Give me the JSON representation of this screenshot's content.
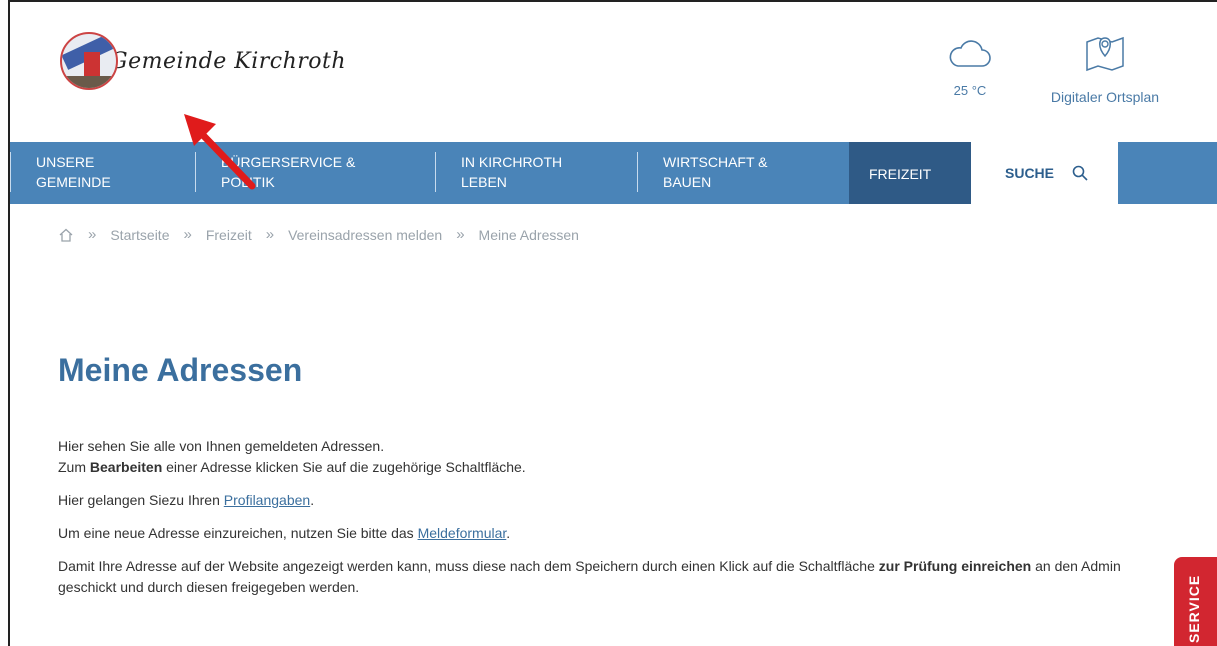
{
  "header": {
    "logo_text": "Gemeinde Kirchroth",
    "weather": {
      "icon": "cloud-icon",
      "temperature": "25 °C"
    },
    "ortsplan": {
      "icon": "map-pin-icon",
      "label": "Digitaler Ortsplan"
    }
  },
  "nav": {
    "items": [
      {
        "line1": "UNSERE",
        "line2": "GEMEINDE"
      },
      {
        "line1": "BÜRGERSERVICE &",
        "line2": "POLITIK"
      },
      {
        "line1": "IN KIRCHROTH",
        "line2": "LEBEN"
      },
      {
        "line1": "WIRTSCHAFT &",
        "line2": "BAUEN"
      }
    ],
    "active": "FREIZEIT",
    "search_label": "SUCHE"
  },
  "breadcrumb": {
    "home_icon": "home-icon",
    "items": [
      "Startseite",
      "Freizeit",
      "Vereinsadressen melden",
      "Meine Adressen"
    ]
  },
  "page": {
    "title": "Meine Adressen",
    "p1_line1": "Hier sehen Sie alle von Ihnen gemeldeten Adressen.",
    "p1_line2_pre": "Zum ",
    "p1_line2_bold": "Bearbeiten",
    "p1_line2_post": " einer Adresse klicken Sie auf die zugehörige Schaltfläche.",
    "p2_pre": "Hier gelangen Siezu Ihren ",
    "p2_link": "Profilangaben",
    "p2_post": ".",
    "p3_pre": "Um eine neue Adresse einzureichen, nutzen Sie bitte das ",
    "p3_link": "Meldeformular",
    "p3_post": ".",
    "p4_pre": "Damit Ihre Adresse auf der Website angezeigt werden kann, muss diese nach dem Speichern durch einen Klick auf die Schaltfläche ",
    "p4_bold": "zur Prüfung einreichen",
    "p4_post": " an den Admin geschickt und durch diesen freigegeben werden."
  },
  "service_tab": "SERVICE",
  "colors": {
    "nav": "#4a84b8",
    "nav_active": "#2f5a86",
    "title": "#3b6f9e",
    "service": "#d22630",
    "arrow": "#e01b1b"
  }
}
